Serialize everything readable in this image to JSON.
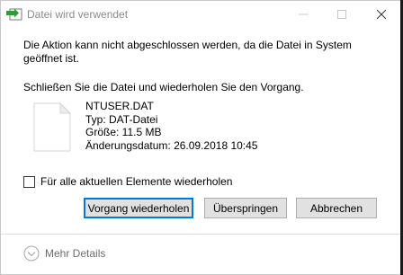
{
  "window": {
    "title": "Datei wird verwendet",
    "minimize_icon": "minimize-icon",
    "maximize_icon": "maximize-icon",
    "close_icon": "close-icon"
  },
  "message": {
    "line1": "Die Aktion kann nicht abgeschlossen werden, da die Datei in System geöffnet ist.",
    "line2": "Schließen Sie die Datei und wiederholen Sie den Vorgang."
  },
  "file": {
    "icon": "document-icon",
    "name": "NTUSER.DAT",
    "type": "Typ: DAT-Datei",
    "size": "Größe: 11.5 MB",
    "modified": "Änderungsdatum: 26.09.2018 10:45"
  },
  "checkbox": {
    "label": "Für alle aktuellen Elemente wiederholen",
    "checked": false
  },
  "buttons": {
    "retry": "Vorgang wiederholen",
    "skip": "Überspringen",
    "cancel": "Abbrechen"
  },
  "details": {
    "label": "Mehr Details",
    "icon": "chevron-down-circle-icon"
  },
  "colors": {
    "accent": "#0078d7",
    "button_bg": "#e1e1e1"
  }
}
